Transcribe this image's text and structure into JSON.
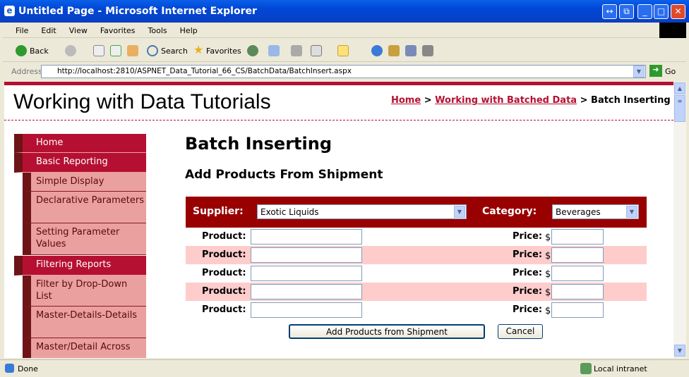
{
  "window": {
    "title": "Untitled Page - Microsoft Internet Explorer"
  },
  "menu": [
    "File",
    "Edit",
    "View",
    "Favorites",
    "Tools",
    "Help"
  ],
  "toolbar": {
    "back": "Back",
    "search": "Search",
    "favorites": "Favorites"
  },
  "address": {
    "label": "Address",
    "url": "http://localhost:2810/ASPNET_Data_Tutorial_66_CS/BatchData/BatchInsert.aspx",
    "go": "Go"
  },
  "site": {
    "title": "Working with Data Tutorials"
  },
  "breadcrumb": {
    "home": "Home",
    "sep": " > ",
    "section": "Working with Batched Data",
    "current": "Batch Inserting"
  },
  "nav": [
    "Home",
    "Basic Reporting",
    "Simple Display",
    "Declarative Parameters",
    "Setting Parameter Values",
    "Filtering Reports",
    "Filter by Drop-Down List",
    "Master-Details-Details",
    "Master/Detail Across"
  ],
  "page": {
    "heading": "Batch Inserting",
    "subheading": "Add Products From Shipment"
  },
  "form": {
    "supplier_label": "Supplier:",
    "supplier_value": "Exotic Liquids",
    "category_label": "Category:",
    "category_value": "Beverages",
    "product_label": "Product:",
    "price_label": "Price:",
    "currency": "$",
    "rows": 5,
    "add_button": "Add Products from Shipment",
    "cancel_button": "Cancel"
  },
  "status": {
    "text": "Done",
    "zone": "Local intranet"
  },
  "colors": {
    "accent": "#b51032",
    "header_row": "#990000",
    "alt_row": "#ffcccc",
    "nav_sub": "#eba0a0"
  }
}
